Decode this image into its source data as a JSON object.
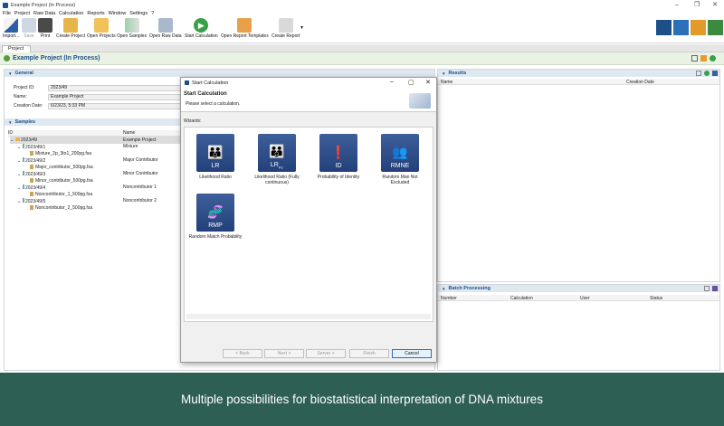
{
  "window": {
    "title": "Example Project (In Process)"
  },
  "menu": [
    "File",
    "Project",
    "Raw Data",
    "Calculation",
    "Reports",
    "Window",
    "Settings",
    "?"
  ],
  "toolbar": [
    {
      "label": "Import..."
    },
    {
      "label": "Save"
    },
    {
      "label": "Print"
    },
    {
      "label": "Create Project"
    },
    {
      "label": "Open Projects"
    },
    {
      "label": "Open Samples"
    },
    {
      "label": "Open Raw Data"
    },
    {
      "label": "Start Calculation"
    },
    {
      "label": "Open Report Templates"
    },
    {
      "label": "Create Report"
    }
  ],
  "project_tab": "Project",
  "project_header": "Example Project (In Process)",
  "general": {
    "title": "General",
    "fields": [
      {
        "label": "Project ID:",
        "value": "2023/49"
      },
      {
        "label": "Name:",
        "value": "Example Project"
      },
      {
        "label": "Creation Date:",
        "value": "6/23/23, 5:33 PM"
      }
    ]
  },
  "samples": {
    "title": "Samples",
    "columns": [
      "ID",
      "Name"
    ],
    "rows": [
      {
        "id": "2023/49",
        "name": "Example Project"
      },
      {
        "id": "2023/49/1",
        "name": "Mixture"
      },
      {
        "id": "Mixture_2p_3to1_200pg.fsa",
        "name": ""
      },
      {
        "id": "2023/49/2",
        "name": "Major Contributor"
      },
      {
        "id": "Major_contributor_500pg.fsa",
        "name": ""
      },
      {
        "id": "2023/49/3",
        "name": "Minor Contributor"
      },
      {
        "id": "Minor_contributor_500pg.fsa",
        "name": ""
      },
      {
        "id": "2023/49/4",
        "name": "Noncontributor 1"
      },
      {
        "id": "Noncontributor_1_500pg.fsa",
        "name": ""
      },
      {
        "id": "2023/49/5",
        "name": "Noncontributor 2"
      },
      {
        "id": "Noncontributor_2_500pg.fsa",
        "name": ""
      }
    ]
  },
  "results": {
    "title": "Results",
    "columns": [
      "Name",
      "Creation Date"
    ]
  },
  "batch": {
    "title": "Batch Processing",
    "columns": [
      "Number",
      "Calculation",
      "User",
      "Status"
    ]
  },
  "dialog": {
    "title": "Start Calculation",
    "heading": "Start Calculation",
    "subtitle": "Please select a calculation.",
    "wizards_label": "Wizards:",
    "wizards": [
      {
        "abbr": "LR",
        "label": "Likelihood Ratio"
      },
      {
        "abbr": "LR",
        "sub": "FC",
        "label": "Likelihood Ratio (Fully continuous)"
      },
      {
        "abbr": "ID",
        "label": "Probability of Identity"
      },
      {
        "abbr": "RMNE",
        "label": "Random Man Not Excluded"
      },
      {
        "abbr": "RMP",
        "label": "Random Match Probability"
      }
    ],
    "buttons": {
      "back": "< Back",
      "next": "Next >",
      "server": "Server >",
      "finish": "Finish",
      "cancel": "Cancel"
    }
  },
  "caption": "Multiple possibilities for biostatistical interpretation of DNA mixtures"
}
